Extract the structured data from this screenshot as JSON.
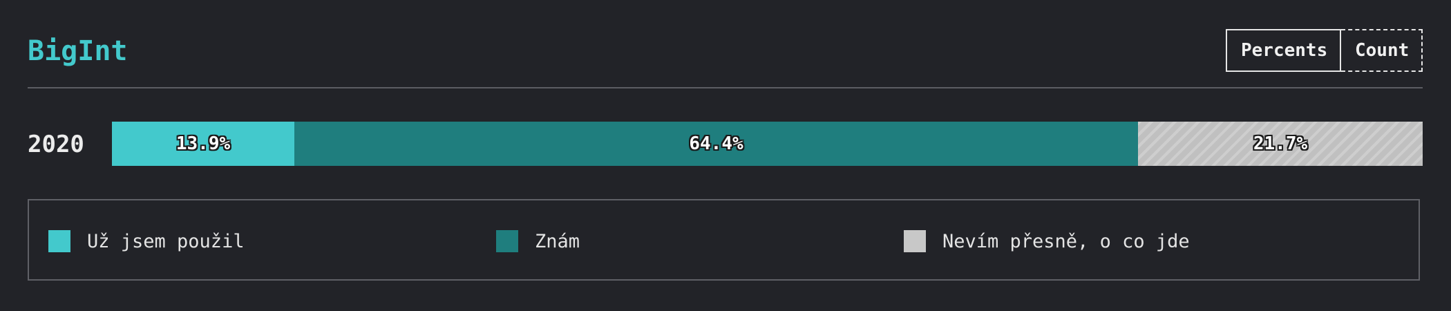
{
  "title": "BigInt",
  "toggle": {
    "percents_label": "Percents",
    "count_label": "Count"
  },
  "colors": {
    "accent": "#43c9cc",
    "used": "#43c9cc",
    "know": "#1f7e7e",
    "unsure": "#c8c8c8"
  },
  "chart_data": {
    "type": "bar",
    "orientation": "horizontal",
    "stacked": true,
    "categories": [
      "2020"
    ],
    "series": [
      {
        "name": "Už jsem použil",
        "values": [
          13.9
        ],
        "color": "#43c9cc"
      },
      {
        "name": "Znám",
        "values": [
          64.4
        ],
        "color": "#1f7e7e"
      },
      {
        "name": "Nevím přesně, o co jde",
        "values": [
          21.7
        ],
        "color": "#c8c8c8"
      }
    ],
    "data_labels": [
      "13.9%",
      "64.4%",
      "21.7%"
    ],
    "xlim": [
      0,
      100
    ],
    "legend_position": "bottom"
  }
}
